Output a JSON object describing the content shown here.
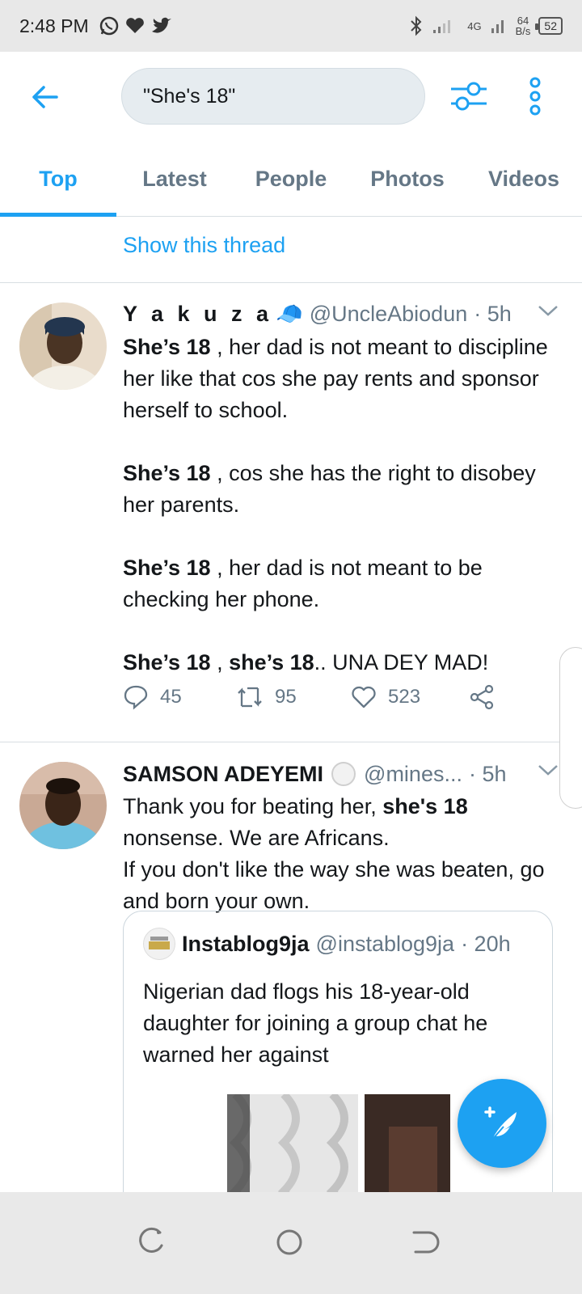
{
  "status_bar": {
    "time": "2:48 PM",
    "network_type": "4G",
    "speed_value": "64",
    "speed_unit": "B/s",
    "battery": "52"
  },
  "search": {
    "query": "\"She's 18\""
  },
  "tabs": [
    {
      "label": "Top",
      "active": true
    },
    {
      "label": "Latest",
      "active": false
    },
    {
      "label": "People",
      "active": false
    },
    {
      "label": "Photos",
      "active": false
    },
    {
      "label": "Videos",
      "active": false
    }
  ],
  "show_thread": "Show this thread",
  "tweets": [
    {
      "name": "Y a k u z a",
      "name_emoji": "🧢",
      "handle": "@UncleAbiodun",
      "time": "· 5h",
      "paragraphs": [
        {
          "bold": "She’s 18",
          "rest": " , her dad is not meant to discipline her like that cos she pay rents and sponsor herself to school."
        },
        {
          "bold": "She’s 18",
          "rest": " , cos she has the right to disobey her parents."
        },
        {
          "bold": "She’s 18",
          "rest": " , her dad is not meant to be checking her phone."
        },
        {
          "bold": "She’s 18",
          "mid": " , ",
          "bold2": "she’s 18",
          "rest": ".. UNA DEY MAD!"
        }
      ],
      "replies": "45",
      "retweets": "95",
      "likes": "523"
    },
    {
      "name": "SAMSON ADEYEMI",
      "handle": "@mines...",
      "time": "· 5h",
      "text_pre": "Thank you for beating her, ",
      "text_bold": "she's 18",
      "text_post": " nonsense. We are Africans.",
      "text_line2": "If you don't like the way she was beaten, go and born your own.",
      "quote": {
        "name": "Instablog9ja",
        "handle": "@instablog9ja",
        "time": "· 20h",
        "text": "Nigerian dad flogs his 18-year-old daughter for joining a group chat he warned her against"
      }
    }
  ],
  "colors": {
    "accent": "#1da1f2",
    "secondary_text": "#657786"
  }
}
